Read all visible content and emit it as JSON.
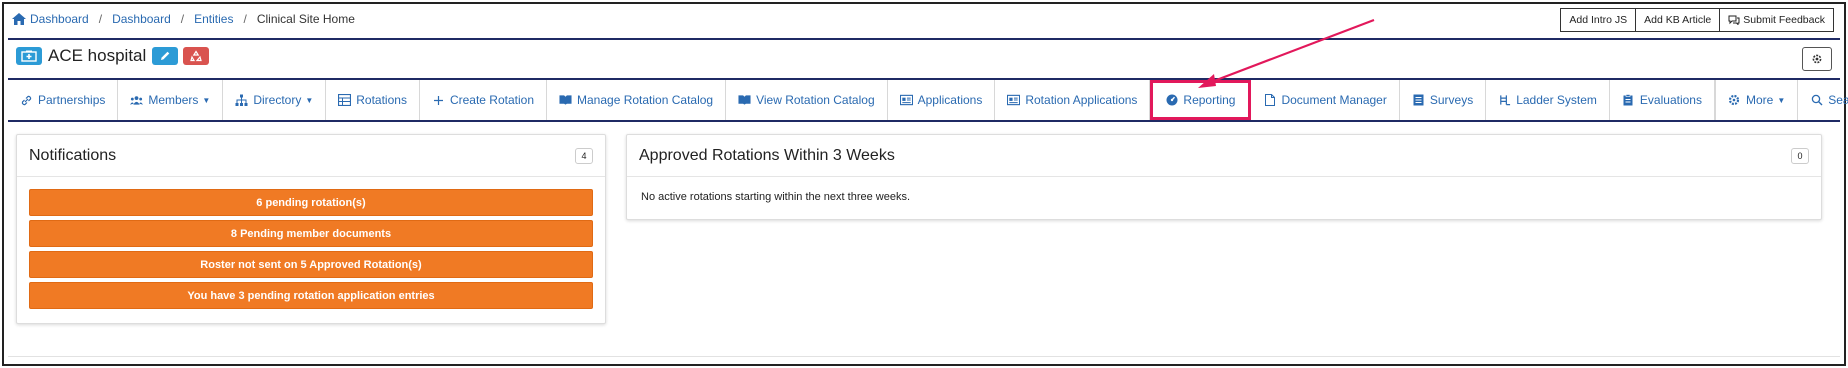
{
  "breadcrumb": {
    "items": [
      "Dashboard",
      "Dashboard",
      "Entities"
    ],
    "current": "Clinical Site Home"
  },
  "top_buttons": {
    "intro": "Add Intro JS",
    "kb": "Add KB Article",
    "feedback": "Submit Feedback"
  },
  "page": {
    "title": "ACE hospital"
  },
  "nav": {
    "partnerships": "Partnerships",
    "members": "Members",
    "directory": "Directory",
    "rotations": "Rotations",
    "create_rotation": "Create Rotation",
    "manage_catalog": "Manage Rotation Catalog",
    "view_catalog": "View Rotation Catalog",
    "applications": "Applications",
    "rotation_applications": "Rotation Applications",
    "reporting": "Reporting",
    "document_manager": "Document Manager",
    "surveys": "Surveys",
    "ladder_system": "Ladder System",
    "evaluations": "Evaluations",
    "more": "More",
    "search": "Search"
  },
  "notifications": {
    "title": "Notifications",
    "count": "4",
    "items": [
      "6 pending rotation(s)",
      "8 Pending member documents",
      "Roster not sent on 5 Approved Rotation(s)",
      "You have 3 pending rotation application entries"
    ]
  },
  "approved_rotations": {
    "title": "Approved Rotations Within 3 Weeks",
    "count": "0",
    "message": "No active rotations starting within the next three weeks."
  },
  "colors": {
    "link": "#2a6ab1",
    "navy_rule": "#1f2a64",
    "notification": "#f07a24",
    "highlight": "#e2185b",
    "info_button": "#2c9bd6",
    "danger_button": "#d9534f"
  }
}
